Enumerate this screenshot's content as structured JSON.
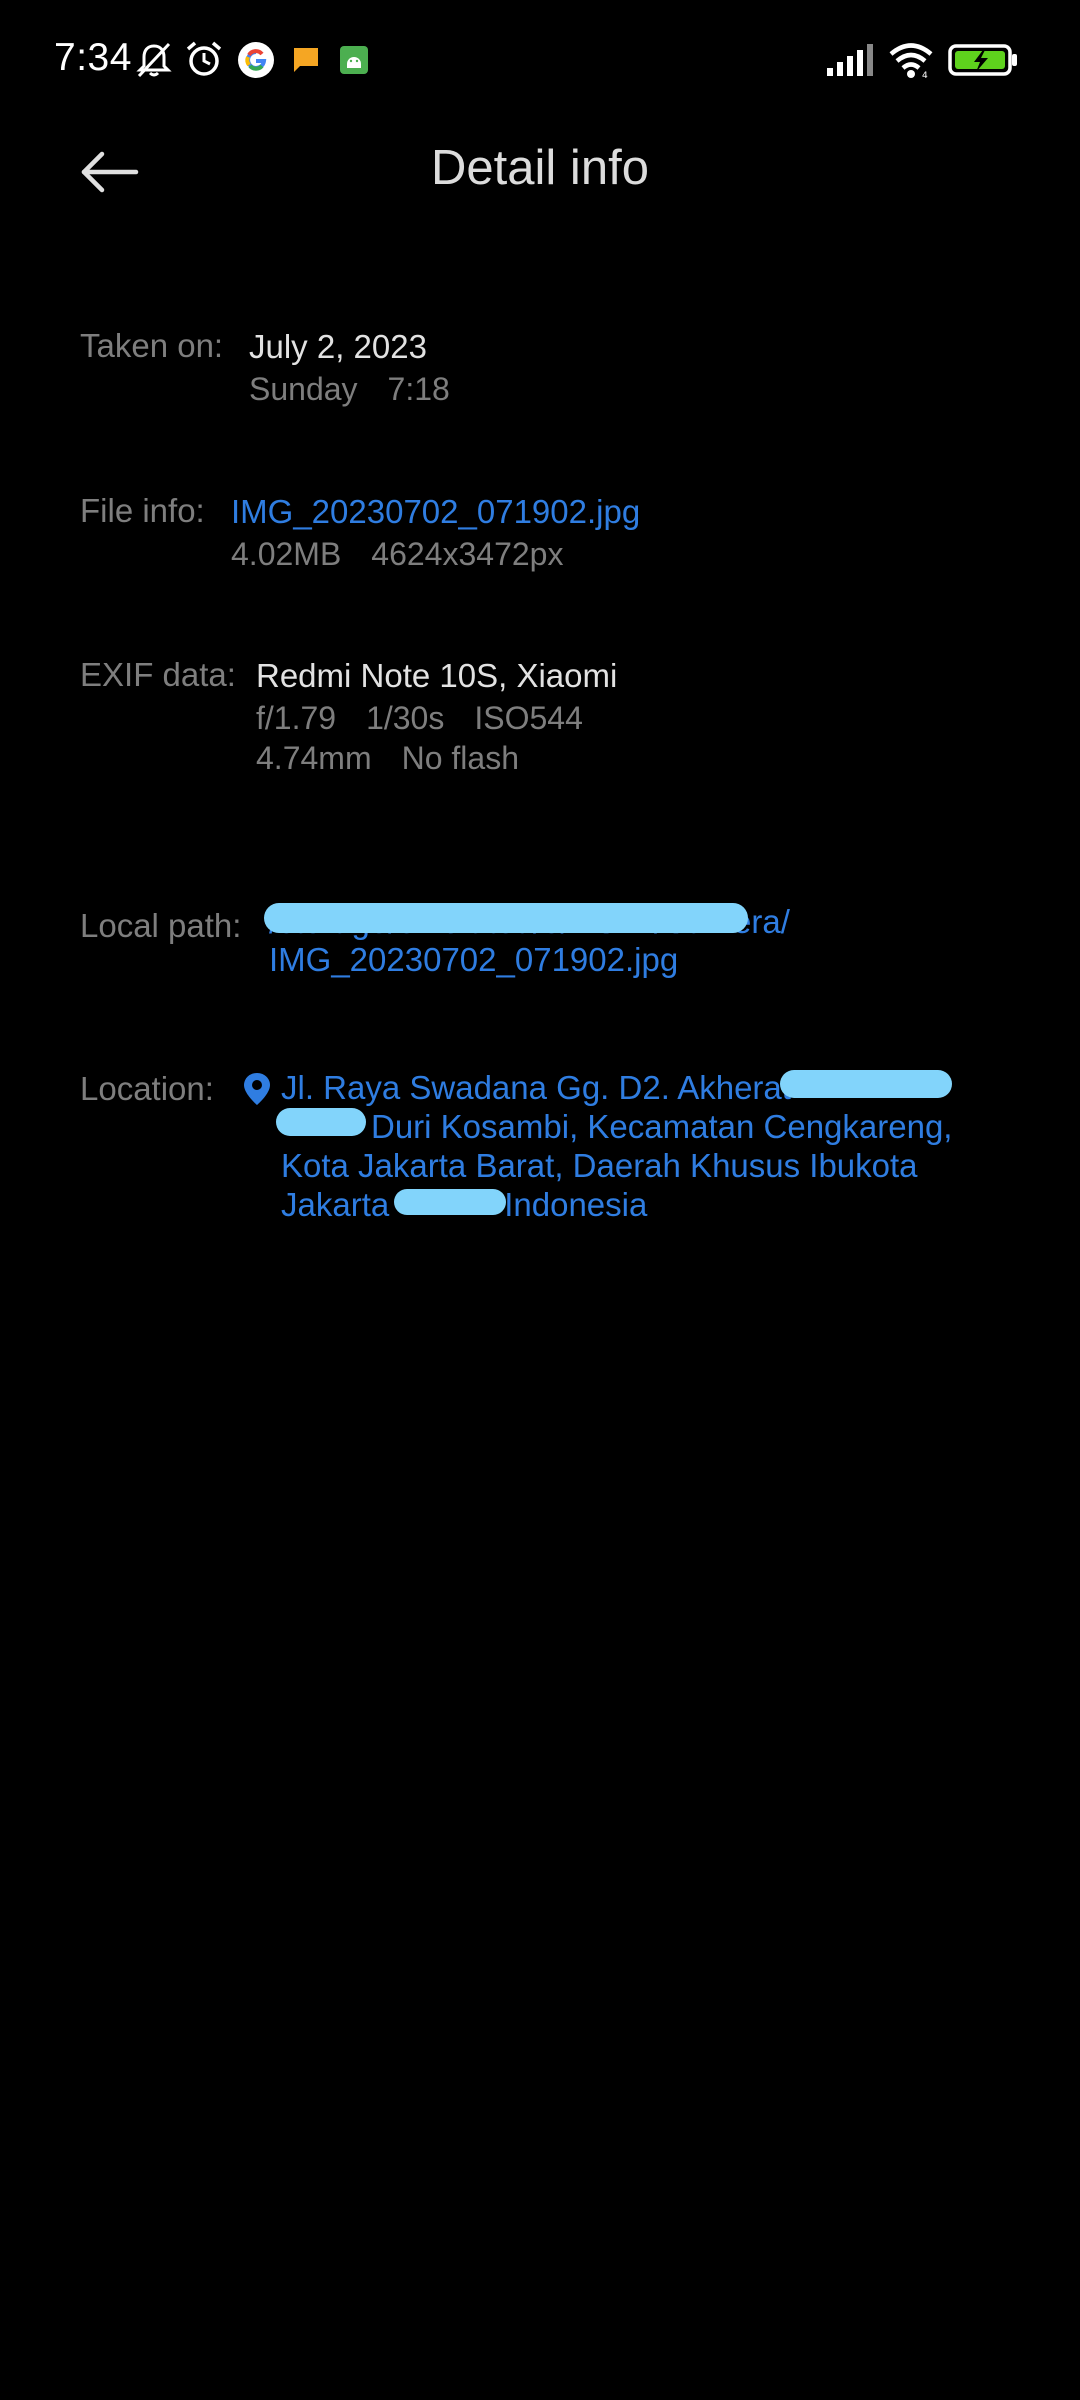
{
  "status_bar": {
    "time": "7:34",
    "icons": [
      "bell-off-icon",
      "alarm-icon",
      "google-icon",
      "message-icon",
      "android-icon",
      "signal-icon",
      "wifi-icon",
      "battery-charging-icon"
    ]
  },
  "header": {
    "title": "Detail info",
    "back_icon": "arrow-left-icon"
  },
  "taken_on": {
    "label": "Taken on:",
    "date": "July 2, 2023",
    "day": "Sunday",
    "time": "7:18"
  },
  "file_info": {
    "label": "File info:",
    "filename": "IMG_20230702_071902.jpg",
    "size": "4.02MB",
    "resolution": "4624x3472px"
  },
  "exif": {
    "label": "EXIF data:",
    "device": "Redmi Note 10S, Xiaomi",
    "aperture": "f/1.79",
    "shutter": "1/30s",
    "iso": "ISO544",
    "focal_length": "4.74mm",
    "flash": "No flash"
  },
  "local_path": {
    "label": "Local path:",
    "line1": "/storage/emulated/0/DCIM/Camera/",
    "line2": "IMG_20230702_071902.jpg"
  },
  "location": {
    "label": "Location:",
    "icon": "location-pin-icon",
    "line1": "Jl. Raya Swadana Gg. D2. Akherat",
    "line2": "Duri Kosambi, Kecamatan Cengkareng,",
    "line3": "Kota Jakarta Barat, Daerah Khusus Ibukota",
    "line4a": "Jakarta",
    "line4b": "Indonesia"
  },
  "colors": {
    "background": "#000000",
    "link": "#2f7de1",
    "label": "#7e7e7e",
    "text": "#e2e2e2",
    "redaction": "#82d4fb"
  }
}
